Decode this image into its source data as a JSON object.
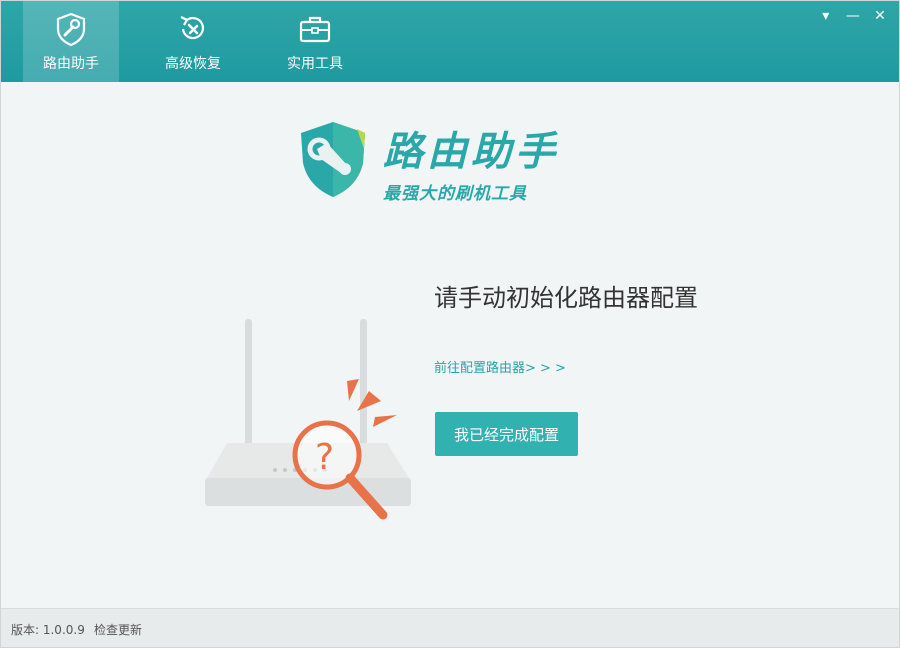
{
  "titlebar": {
    "tabs": [
      {
        "label": "路由助手",
        "icon": "shield-wrench-icon",
        "active": true
      },
      {
        "label": "高级恢复",
        "icon": "restore-icon",
        "active": false
      },
      {
        "label": "实用工具",
        "icon": "toolbox-icon",
        "active": false
      }
    ],
    "controls": {
      "menu": "▾",
      "minimize": "—",
      "close": "✕"
    }
  },
  "logo": {
    "title": "路由助手",
    "subtitle": "最强大的刷机工具"
  },
  "main": {
    "heading": "请手动初始化路由器配置",
    "link": "前往配置路由器> > >",
    "done_button": "我已经完成配置"
  },
  "statusbar": {
    "version": "版本: 1.0.0.9",
    "update": "检查更新"
  },
  "colors": {
    "accent": "#2aa8a9",
    "titlebar": "#23a0a3",
    "button": "#31b1b0",
    "magnifier": "#e8734a"
  }
}
